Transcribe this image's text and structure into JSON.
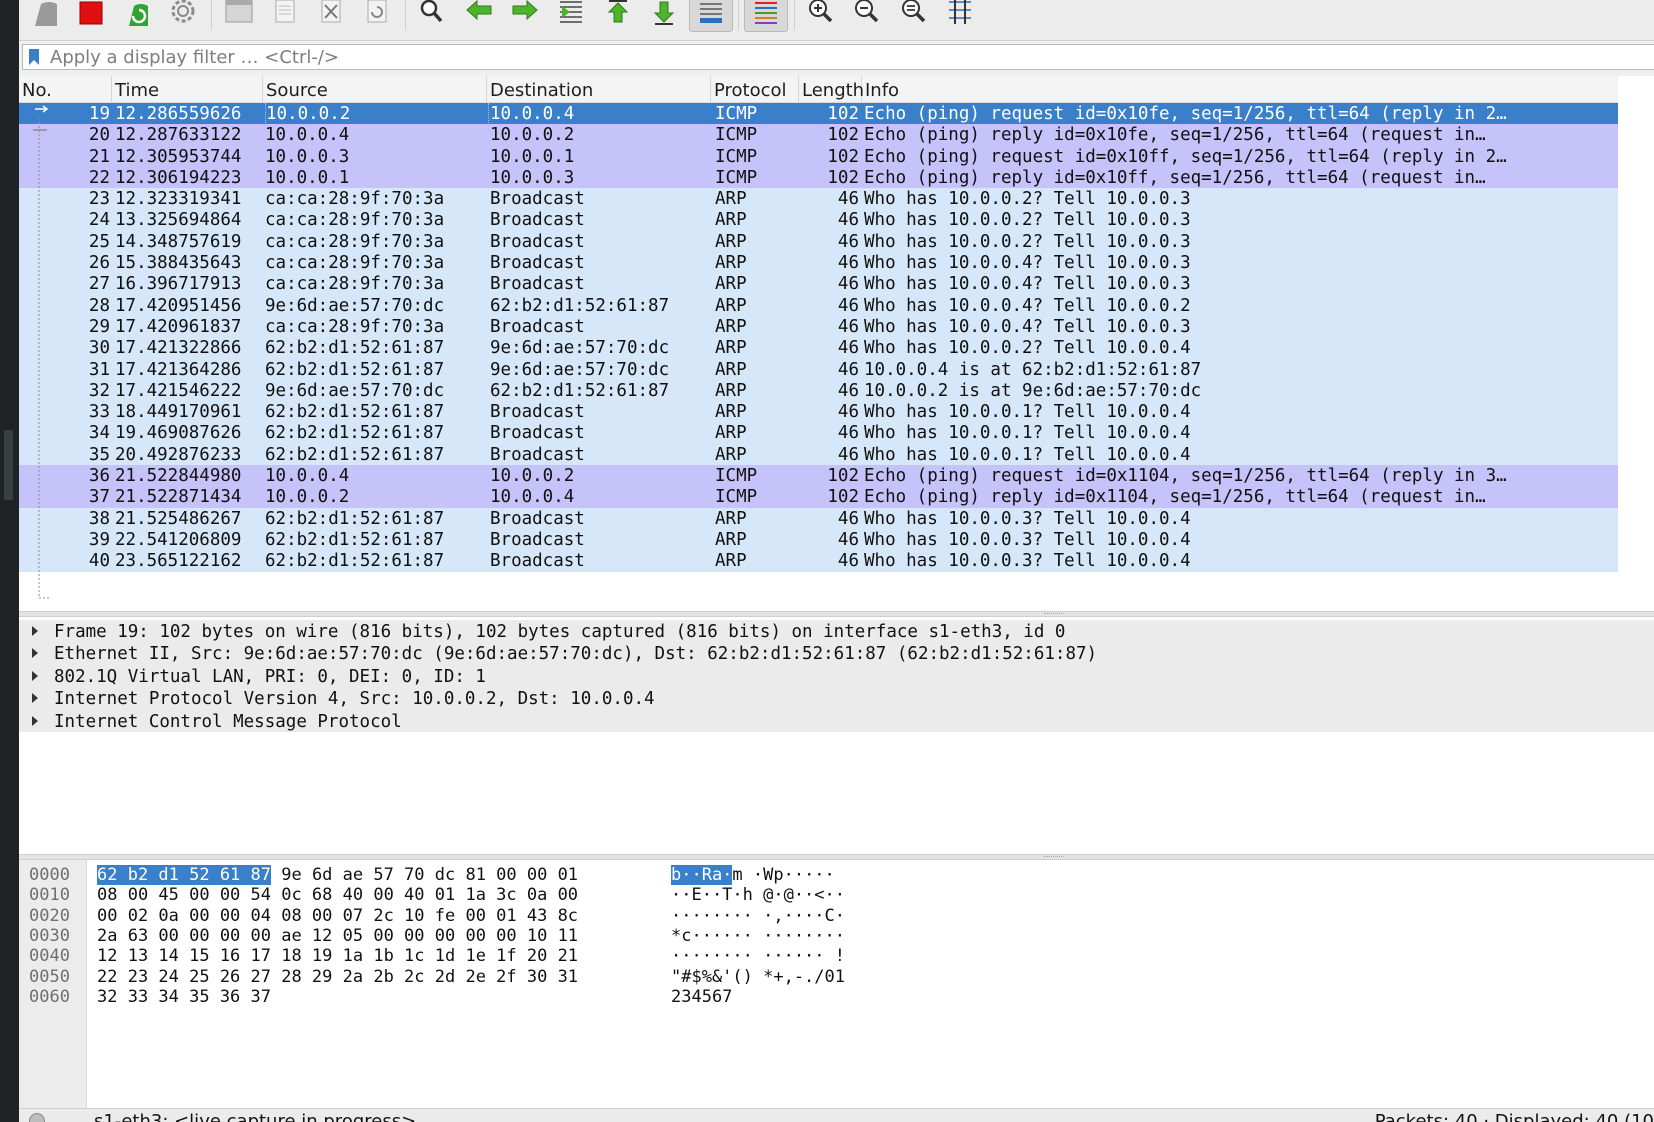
{
  "colors": {
    "selected_row": "#3a7fc9",
    "icmp_row": "#c6c3fb",
    "arp_row": "#d6e7f9",
    "hex_highlight": "#3a7fc9"
  },
  "toolbar": {
    "items": [
      "shark-fin-start-icon",
      "stop-square-icon",
      "restart-capture-icon",
      "capture-options-gear-icon",
      "open-file-icon",
      "save-file-icon",
      "close-file-icon",
      "reload-file-icon",
      "find-packet-icon",
      "go-back-arrow-icon",
      "go-forward-arrow-icon",
      "go-to-packet-icon",
      "go-first-packet-icon",
      "go-last-packet-icon",
      "autoscroll-icon",
      "colorize-icon",
      "zoom-in-icon",
      "zoom-out-icon",
      "zoom-normal-icon",
      "resize-columns-icon"
    ]
  },
  "filter": {
    "placeholder": "Apply a display filter … <Ctrl-/>"
  },
  "packet_list": {
    "columns": [
      "No.",
      "Time",
      "Source",
      "Destination",
      "Protocol",
      "Length",
      "Info"
    ],
    "rows": [
      {
        "no": "19",
        "time": "12.286559626",
        "src": "10.0.0.2",
        "dst": "10.0.0.4",
        "proto": "ICMP",
        "len": "102",
        "info": "Echo (ping) request  id=0x10fe, seq=1/256, ttl=64 (reply in 2…",
        "kind": "sel"
      },
      {
        "no": "20",
        "time": "12.287633122",
        "src": "10.0.0.4",
        "dst": "10.0.0.2",
        "proto": "ICMP",
        "len": "102",
        "info": "Echo (ping) reply    id=0x10fe, seq=1/256, ttl=64 (request in…",
        "kind": "icmp"
      },
      {
        "no": "21",
        "time": "12.305953744",
        "src": "10.0.0.3",
        "dst": "10.0.0.1",
        "proto": "ICMP",
        "len": "102",
        "info": "Echo (ping) request  id=0x10ff, seq=1/256, ttl=64 (reply in 2…",
        "kind": "icmp"
      },
      {
        "no": "22",
        "time": "12.306194223",
        "src": "10.0.0.1",
        "dst": "10.0.0.3",
        "proto": "ICMP",
        "len": "102",
        "info": "Echo (ping) reply    id=0x10ff, seq=1/256, ttl=64 (request in…",
        "kind": "icmp"
      },
      {
        "no": "23",
        "time": "12.323319341",
        "src": "ca:ca:28:9f:70:3a",
        "dst": "Broadcast",
        "proto": "ARP",
        "len": "46",
        "info": "Who has 10.0.0.2? Tell 10.0.0.3",
        "kind": "arp"
      },
      {
        "no": "24",
        "time": "13.325694864",
        "src": "ca:ca:28:9f:70:3a",
        "dst": "Broadcast",
        "proto": "ARP",
        "len": "46",
        "info": "Who has 10.0.0.2? Tell 10.0.0.3",
        "kind": "arp"
      },
      {
        "no": "25",
        "time": "14.348757619",
        "src": "ca:ca:28:9f:70:3a",
        "dst": "Broadcast",
        "proto": "ARP",
        "len": "46",
        "info": "Who has 10.0.0.2? Tell 10.0.0.3",
        "kind": "arp"
      },
      {
        "no": "26",
        "time": "15.388435643",
        "src": "ca:ca:28:9f:70:3a",
        "dst": "Broadcast",
        "proto": "ARP",
        "len": "46",
        "info": "Who has 10.0.0.4? Tell 10.0.0.3",
        "kind": "arp"
      },
      {
        "no": "27",
        "time": "16.396717913",
        "src": "ca:ca:28:9f:70:3a",
        "dst": "Broadcast",
        "proto": "ARP",
        "len": "46",
        "info": "Who has 10.0.0.4? Tell 10.0.0.3",
        "kind": "arp"
      },
      {
        "no": "28",
        "time": "17.420951456",
        "src": "9e:6d:ae:57:70:dc",
        "dst": "62:b2:d1:52:61:87",
        "proto": "ARP",
        "len": "46",
        "info": "Who has 10.0.0.4? Tell 10.0.0.2",
        "kind": "arp"
      },
      {
        "no": "29",
        "time": "17.420961837",
        "src": "ca:ca:28:9f:70:3a",
        "dst": "Broadcast",
        "proto": "ARP",
        "len": "46",
        "info": "Who has 10.0.0.4? Tell 10.0.0.3",
        "kind": "arp"
      },
      {
        "no": "30",
        "time": "17.421322866",
        "src": "62:b2:d1:52:61:87",
        "dst": "9e:6d:ae:57:70:dc",
        "proto": "ARP",
        "len": "46",
        "info": "Who has 10.0.0.2? Tell 10.0.0.4",
        "kind": "arp"
      },
      {
        "no": "31",
        "time": "17.421364286",
        "src": "62:b2:d1:52:61:87",
        "dst": "9e:6d:ae:57:70:dc",
        "proto": "ARP",
        "len": "46",
        "info": "10.0.0.4 is at 62:b2:d1:52:61:87",
        "kind": "arp"
      },
      {
        "no": "32",
        "time": "17.421546222",
        "src": "9e:6d:ae:57:70:dc",
        "dst": "62:b2:d1:52:61:87",
        "proto": "ARP",
        "len": "46",
        "info": "10.0.0.2 is at 9e:6d:ae:57:70:dc",
        "kind": "arp"
      },
      {
        "no": "33",
        "time": "18.449170961",
        "src": "62:b2:d1:52:61:87",
        "dst": "Broadcast",
        "proto": "ARP",
        "len": "46",
        "info": "Who has 10.0.0.1? Tell 10.0.0.4",
        "kind": "arp"
      },
      {
        "no": "34",
        "time": "19.469087626",
        "src": "62:b2:d1:52:61:87",
        "dst": "Broadcast",
        "proto": "ARP",
        "len": "46",
        "info": "Who has 10.0.0.1? Tell 10.0.0.4",
        "kind": "arp"
      },
      {
        "no": "35",
        "time": "20.492876233",
        "src": "62:b2:d1:52:61:87",
        "dst": "Broadcast",
        "proto": "ARP",
        "len": "46",
        "info": "Who has 10.0.0.1? Tell 10.0.0.4",
        "kind": "arp"
      },
      {
        "no": "36",
        "time": "21.522844980",
        "src": "10.0.0.4",
        "dst": "10.0.0.2",
        "proto": "ICMP",
        "len": "102",
        "info": "Echo (ping) request  id=0x1104, seq=1/256, ttl=64 (reply in 3…",
        "kind": "icmp"
      },
      {
        "no": "37",
        "time": "21.522871434",
        "src": "10.0.0.2",
        "dst": "10.0.0.4",
        "proto": "ICMP",
        "len": "102",
        "info": "Echo (ping) reply    id=0x1104, seq=1/256, ttl=64 (request in…",
        "kind": "icmp"
      },
      {
        "no": "38",
        "time": "21.525486267",
        "src": "62:b2:d1:52:61:87",
        "dst": "Broadcast",
        "proto": "ARP",
        "len": "46",
        "info": "Who has 10.0.0.3? Tell 10.0.0.4",
        "kind": "arp"
      },
      {
        "no": "39",
        "time": "22.541206809",
        "src": "62:b2:d1:52:61:87",
        "dst": "Broadcast",
        "proto": "ARP",
        "len": "46",
        "info": "Who has 10.0.0.3? Tell 10.0.0.4",
        "kind": "arp"
      },
      {
        "no": "40",
        "time": "23.565122162",
        "src": "62:b2:d1:52:61:87",
        "dst": "Broadcast",
        "proto": "ARP",
        "len": "46",
        "info": "Who has 10.0.0.3? Tell 10.0.0.4",
        "kind": "arp"
      }
    ]
  },
  "details": {
    "items": [
      "Frame 19: 102 bytes on wire (816 bits), 102 bytes captured (816 bits) on interface s1-eth3, id 0",
      "Ethernet II, Src: 9e:6d:ae:57:70:dc (9e:6d:ae:57:70:dc), Dst: 62:b2:d1:52:61:87 (62:b2:d1:52:61:87)",
      "802.1Q Virtual LAN, PRI: 0, DEI: 0, ID: 1",
      "Internet Protocol Version 4, Src: 10.0.0.2, Dst: 10.0.0.4",
      "Internet Control Message Protocol"
    ]
  },
  "bytes": {
    "rows": [
      {
        "offset": "0000",
        "hex_hl": "62 b2 d1 52 61 87",
        "hex": " 9e 6d  ae 57 70 dc 81 00 00 01",
        "ascii_hl": "b··Ra·",
        "ascii": "m ·Wp·····"
      },
      {
        "offset": "0010",
        "hex_hl": "",
        "hex": "08 00 45 00 00 54 0c 68  40 00 40 01 1a 3c 0a 00",
        "ascii_hl": "",
        "ascii": "··E··T·h @·@··<··"
      },
      {
        "offset": "0020",
        "hex_hl": "",
        "hex": "00 02 0a 00 00 04 08 00  07 2c 10 fe 00 01 43 8c",
        "ascii_hl": "",
        "ascii": "········ ·,····C·"
      },
      {
        "offset": "0030",
        "hex_hl": "",
        "hex": "2a 63 00 00 00 00 ae 12  05 00 00 00 00 00 10 11",
        "ascii_hl": "",
        "ascii": "*c······ ········"
      },
      {
        "offset": "0040",
        "hex_hl": "",
        "hex": "12 13 14 15 16 17 18 19  1a 1b 1c 1d 1e 1f 20 21",
        "ascii_hl": "",
        "ascii": "········ ······ !"
      },
      {
        "offset": "0050",
        "hex_hl": "",
        "hex": "22 23 24 25 26 27 28 29  2a 2b 2c 2d 2e 2f 30 31",
        "ascii_hl": "",
        "ascii": "\"#$%&'() *+,-./01"
      },
      {
        "offset": "0060",
        "hex_hl": "",
        "hex": "32 33 34 35 36 37",
        "ascii_hl": "",
        "ascii": "234567"
      }
    ]
  },
  "status": {
    "left": "s1-eth3: <live capture in progress>",
    "right": "Packets: 40 · Displayed: 40 (10"
  }
}
